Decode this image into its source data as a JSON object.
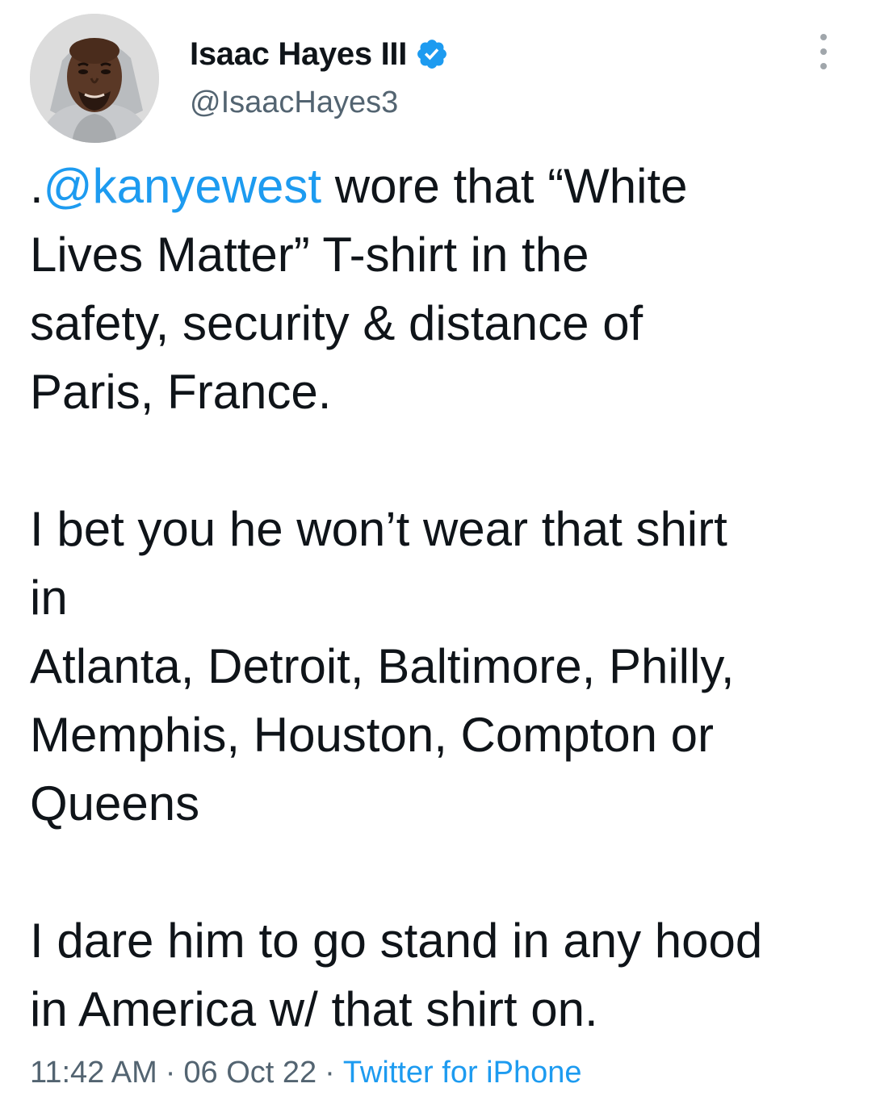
{
  "author": {
    "display_name": "Isaac Hayes III",
    "handle": "@IsaacHayes3",
    "verified": true,
    "avatar_icon": "profile-photo",
    "verified_icon": "verified-badge-icon"
  },
  "menu": {
    "icon": "more-options-icon"
  },
  "tweet": {
    "prefix": ".",
    "mention": "@kanyewest",
    "line1_rest": " wore that “White",
    "line2": "Lives Matter” T-shirt in the",
    "line3": "safety, security & distance of",
    "line4": "Paris, France.",
    "line5": "I bet you he won’t wear that shirt",
    "line6": "in",
    "line7": "Atlanta, Detroit, Baltimore, Philly,",
    "line8": "Memphis, Houston, Compton or",
    "line9": "Queens",
    "line10": "I dare him to go stand in any hood",
    "line11": "in America w/ that shirt on."
  },
  "meta": {
    "time": "11:42 AM",
    "separator": "·",
    "date": "06 Oct 22",
    "source": "Twitter for iPhone"
  },
  "colors": {
    "accent": "#1d9bf0",
    "text": "#0f1419",
    "secondary": "#536471"
  }
}
